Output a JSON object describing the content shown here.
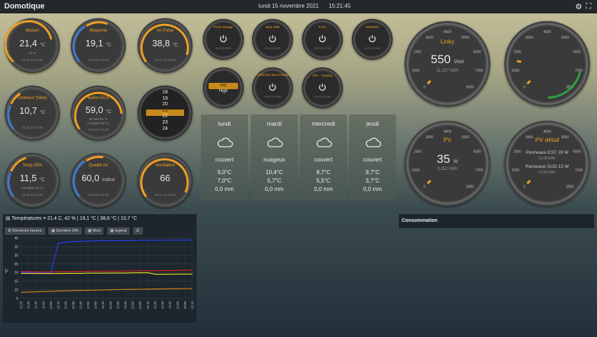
{
  "header": {
    "title": "Domotique",
    "date": "lundi 15 novembre 2021",
    "time": "15:21:45"
  },
  "gauges": [
    {
      "name": "maison",
      "label": "Maison",
      "value": "21,4",
      "unit": "°C",
      "sub": "42 %",
      "ts": "15.11.21 15:20"
    },
    {
      "name": "moyenne",
      "label": "Moyenne",
      "value": "19,1",
      "unit": "°C",
      "sub": "",
      "ts": "15.11.21 15:20"
    },
    {
      "name": "air-pulse",
      "label": "Air Pulsé",
      "value": "38,8",
      "unit": "°C",
      "sub": "",
      "ts": "15.11.21 15:20"
    },
    {
      "name": "exterieur",
      "label": "Extérieur (Nibe)",
      "value": "10,7",
      "unit": "°C",
      "sub": "",
      "ts": "15.11.21 15:20"
    },
    {
      "name": "ballon-ecs",
      "label": "Ballon ECS",
      "value": "59,0",
      "unit": "°C",
      "sub": "En bas 55 °C",
      "sub2": "Consigne 60 °C",
      "ts": "15.11.21 15:20"
    },
    {
      "name": "temp-spa",
      "label": "Temp SPA",
      "value": "11,5",
      "unit": "°C",
      "sub": "Consigne 10 °C",
      "ts": "15.11.21 15:20"
    },
    {
      "name": "qualite-air",
      "label": "Qualité Air",
      "value": "60,0",
      "unit": "Indice",
      "sub": "",
      "ts": "15.11.21 15:20"
    },
    {
      "name": "ventilation",
      "label": "Ventilation",
      "value": "66",
      "unit": "",
      "sub": "",
      "ts": "15.11.21 15:20"
    }
  ],
  "roller": {
    "values": [
      "18",
      "19",
      "20",
      "21",
      "22",
      "23",
      "24"
    ],
    "selected": "21"
  },
  "switches": [
    {
      "name": "porte-garage",
      "label": "Porte Garage",
      "ts": "15.11.21 08:02"
    },
    {
      "name": "spot-sdb",
      "label": "Spot SDB",
      "ts": "15.11.21 09:21"
    },
    {
      "name": "frolo",
      "label": "Frolo",
      "ts": "15.11.21 07:54"
    },
    {
      "name": "aerosol",
      "label": "AEROSO",
      "ts": "15.11.21 11:30"
    },
    {
      "name": "production-eau-chaude",
      "label": "Production Eau Chaude",
      "ts": "15.11.21 12:00"
    },
    {
      "name": "spa-heating",
      "label": "SPA - Heating",
      "ts": "15.11.21 14:58"
    }
  ],
  "vmc": {
    "label": "VMC",
    "value": "High"
  },
  "weather": [
    {
      "day": "lundi",
      "cond": "couvert",
      "max": "9,0°C",
      "min": "7,0°C",
      "rain": "0,0 mm"
    },
    {
      "day": "mardi",
      "cond": "nuageux",
      "max": "10,4°C",
      "min": "5,7°C",
      "rain": "0,0 mm"
    },
    {
      "day": "mercredi",
      "cond": "couvert",
      "max": "8,7°C",
      "min": "5,5°C",
      "rain": "0,0 mm"
    },
    {
      "day": "jeudi",
      "cond": "couvert",
      "max": "9,7°C",
      "min": "3,7°C",
      "rain": "0,0 mm"
    }
  ],
  "power": {
    "linky": {
      "label": "Linky",
      "value": "550",
      "unit": "Watt",
      "sub": "11,227 kWh"
    },
    "pv": {
      "label": "PV",
      "value": "35",
      "unit": "W",
      "sub": "0,252 kWh"
    },
    "pv_detail": {
      "label": "PV détail",
      "line1": "Panneaux EST 19 W",
      "line1b": "0,139 kWh",
      "line2": "Panneaux SUD 15 W",
      "line2b": "0,113 kWh"
    },
    "scale": [
      "0",
      "1000",
      "2000",
      "3000",
      "4000",
      "5000",
      "6000",
      "7000",
      "8000"
    ]
  },
  "chart_panel": {
    "title": "Températures",
    "summary": "21,4 C, 42 % | 19,1 °C | 38,8 °C | 10,7 °C",
    "buttons": [
      "Dernières heures",
      "Dernière 24h",
      "Mois",
      "legend"
    ]
  },
  "conso": {
    "title": "Consommation"
  },
  "chart_data": {
    "type": "line",
    "x": [
      "11:25",
      "11:35",
      "11:45",
      "11:55",
      "12:05",
      "12:15",
      "12:25",
      "12:35",
      "12:45",
      "12:55",
      "13:05",
      "13:15",
      "13:25",
      "13:35",
      "13:45",
      "13:55",
      "14:05",
      "14:15",
      "14:25",
      "14:35",
      "14:45",
      "14:55",
      "15:05",
      "15:15"
    ],
    "ylabel": "°C",
    "ylim": [
      5,
      40
    ],
    "yticks": [
      "40",
      "35",
      "30",
      "25",
      "20",
      "15",
      "10",
      "5"
    ],
    "series": [
      {
        "color": "#2a3cff",
        "values": [
          20,
          20,
          20,
          20,
          20,
          37,
          37.5,
          38,
          38,
          38.3,
          38.5,
          38.5,
          38.5,
          38.5,
          38.6,
          38.6,
          38.7,
          38.7,
          38.7,
          38.7,
          38.8,
          38.8,
          38.8,
          38.8
        ]
      },
      {
        "color": "#e02020",
        "values": [
          20.5,
          20.5,
          20.4,
          20.3,
          20.4,
          20.5,
          20.5,
          20.6,
          20.6,
          20.7,
          20.7,
          20.8,
          20.8,
          20.8,
          20.9,
          20.9,
          21,
          21,
          21,
          21.1,
          21.1,
          21.2,
          21.3,
          21.4
        ]
      },
      {
        "color": "#f0e020",
        "values": [
          19.5,
          19.5,
          19.4,
          19.4,
          19.4,
          19.4,
          19.5,
          19.5,
          19.5,
          19.6,
          19.6,
          19.6,
          19.7,
          19.7,
          19.7,
          19.8,
          19.8,
          19.9,
          19,
          19,
          19,
          19.1,
          19.1,
          19.1
        ]
      },
      {
        "color": "#e08a10",
        "values": [
          8.5,
          8.7,
          8.8,
          9,
          9.1,
          9.3,
          9.4,
          9.5,
          9.6,
          9.7,
          9.8,
          9.9,
          10,
          10.1,
          10.2,
          10.2,
          10.3,
          10.4,
          10.4,
          10.5,
          10.6,
          10.6,
          10.7,
          10.7
        ]
      }
    ]
  },
  "colors": {
    "accent": "#f0a020",
    "blue": "#3a7bd5",
    "green": "#2ea043"
  }
}
